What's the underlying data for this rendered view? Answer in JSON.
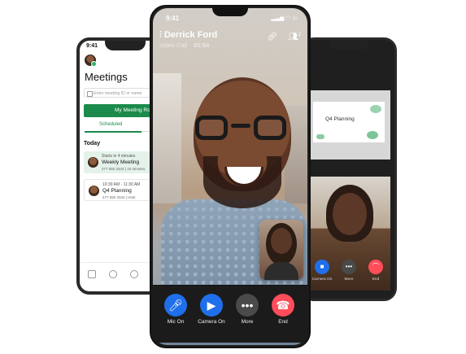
{
  "left_phone": {
    "status_time": "9:41",
    "title": "Meetings",
    "search_placeholder": "Enter meeting ID or name",
    "my_meeting_room_label": "My Meeting Ro...",
    "tab_scheduled": "Scheduled",
    "section_today": "Today",
    "cards": [
      {
        "line1": "Starts in 4 minutes",
        "title": "Weekly Meeting",
        "line3": "477 592 3342  |  15 minutes"
      },
      {
        "line1": "10:30 AM - 11:30 AM",
        "title": "Q4 Planning",
        "line3": "477 592 3342  |  Host"
      }
    ]
  },
  "main_phone": {
    "status_time": "9:41",
    "caller_name": "Derrick Ford",
    "call_type": "Video Call",
    "call_time": "01:54",
    "participants_count": "2",
    "controls": [
      {
        "label": "Mic On",
        "color": "#1f6feb",
        "icon": "mic-icon"
      },
      {
        "label": "Camera On",
        "color": "#1f6feb",
        "icon": "camera-icon"
      },
      {
        "label": "More",
        "color": "#4a4a4a",
        "icon": "more-icon"
      },
      {
        "label": "End",
        "color": "#ff4d5a",
        "icon": "end-call-icon"
      }
    ]
  },
  "right_phone": {
    "shared_slide_title": "Q4 Planning",
    "controls": [
      {
        "label": "Camera On",
        "color": "#1f6feb",
        "icon": "camera-icon"
      },
      {
        "label": "More",
        "color": "#4a4a4a",
        "icon": "more-icon"
      },
      {
        "label": "End",
        "color": "#ff4d5a",
        "icon": "end-call-icon"
      }
    ]
  }
}
